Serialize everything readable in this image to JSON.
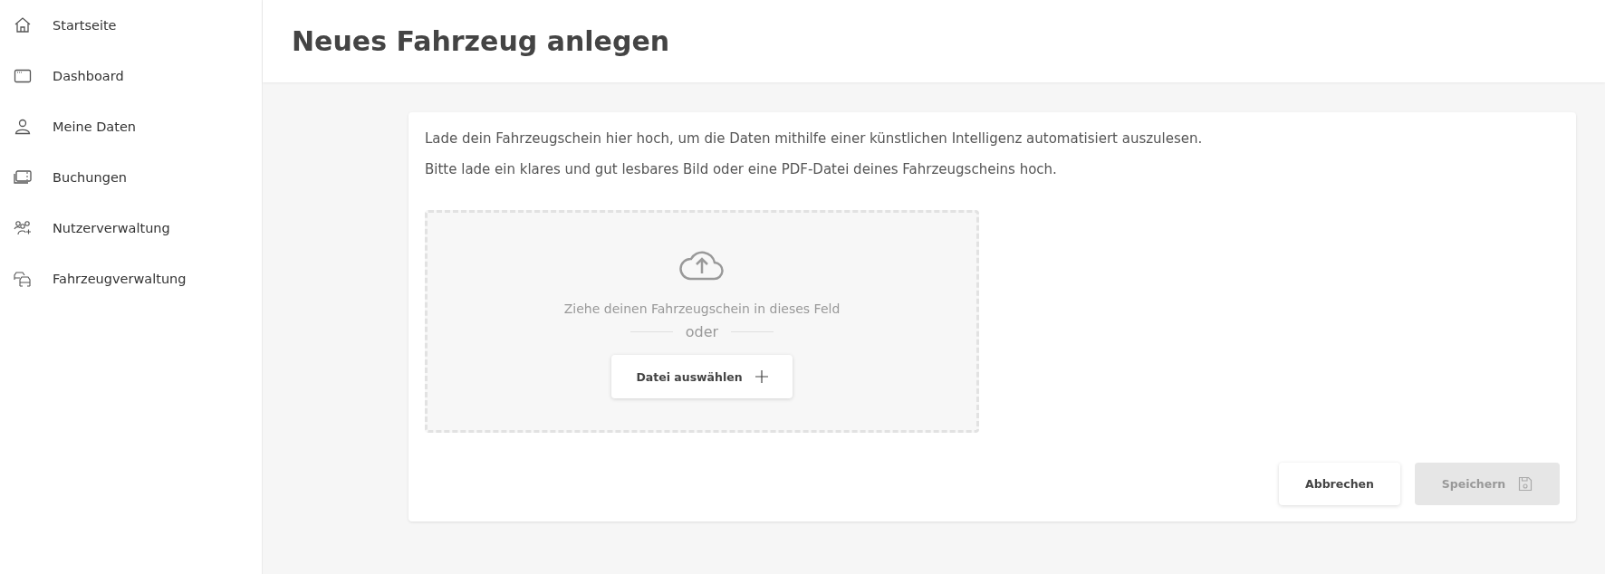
{
  "sidebar": {
    "items": [
      {
        "label": "Startseite"
      },
      {
        "label": "Dashboard"
      },
      {
        "label": "Meine Daten"
      },
      {
        "label": "Buchungen"
      },
      {
        "label": "Nutzerverwaltung"
      },
      {
        "label": "Fahrzeugverwaltung"
      }
    ]
  },
  "page": {
    "title": "Neues Fahrzeug anlegen"
  },
  "card": {
    "intro": [
      "Lade dein Fahrzeugschein hier hoch, um die Daten mithilfe einer künstlichen Intelligenz automatisiert auszulesen.",
      "Bitte lade ein klares und gut lesbares Bild oder eine PDF-Datei deines Fahrzeugscheins hoch."
    ],
    "dropzone": {
      "hint": "Ziehe deinen Fahrzeugschein in dieses Feld",
      "separator": "oder",
      "button": "Datei auswählen"
    },
    "buttons": [
      {
        "label": "Abbrechen",
        "kind": "cancel",
        "disabled": false
      },
      {
        "label": "Speichern",
        "kind": "save",
        "disabled": true
      }
    ]
  }
}
